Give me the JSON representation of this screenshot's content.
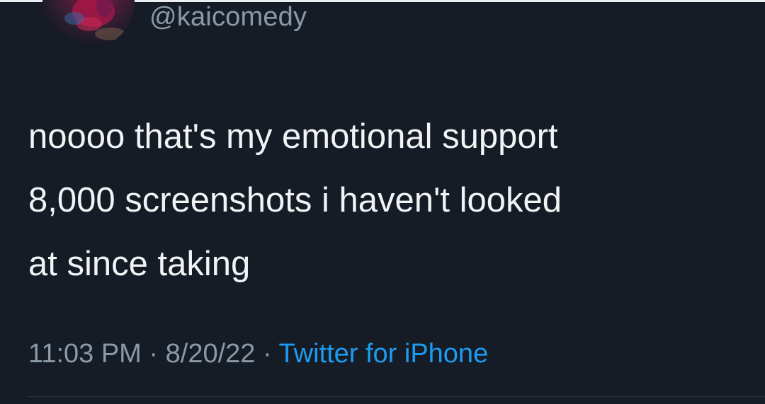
{
  "tweet": {
    "handle": "@kaicomedy",
    "text_lines": [
      "noooo that's my emotional support",
      "8,000 screenshots i haven't looked",
      "at since taking"
    ],
    "time": "11:03 PM",
    "separator": "·",
    "date": "8/20/22",
    "source": "Twitter for iPhone"
  },
  "colors": {
    "background": "#151c26",
    "text": "#f1f3f5",
    "secondary_text": "#8b98a5",
    "link": "#1d9bf0"
  }
}
